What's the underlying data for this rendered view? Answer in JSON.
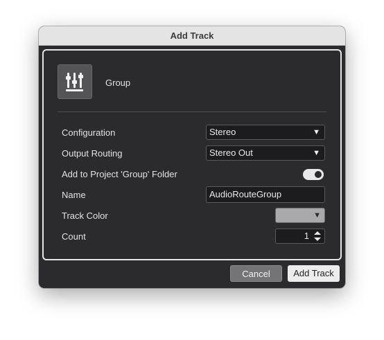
{
  "window": {
    "title": "Add Track"
  },
  "track_type": {
    "label": "Group",
    "icon": "group-channel-icon"
  },
  "fields": {
    "configuration": {
      "label": "Configuration",
      "value": "Stereo"
    },
    "output_routing": {
      "label": "Output Routing",
      "value": "Stereo Out"
    },
    "add_to_folder": {
      "label": "Add to Project 'Group' Folder",
      "enabled": true
    },
    "name": {
      "label": "Name",
      "value": "AudioRouteGroup"
    },
    "track_color": {
      "label": "Track Color",
      "color": "#a9a9ab"
    },
    "count": {
      "label": "Count",
      "value": "1"
    }
  },
  "buttons": {
    "cancel": "Cancel",
    "add_track": "Add Track"
  },
  "colors": {
    "dialog_bg": "#2b2b2d",
    "field_bg": "#1c1c1e",
    "titlebar_bg": "#e4e4e4"
  }
}
